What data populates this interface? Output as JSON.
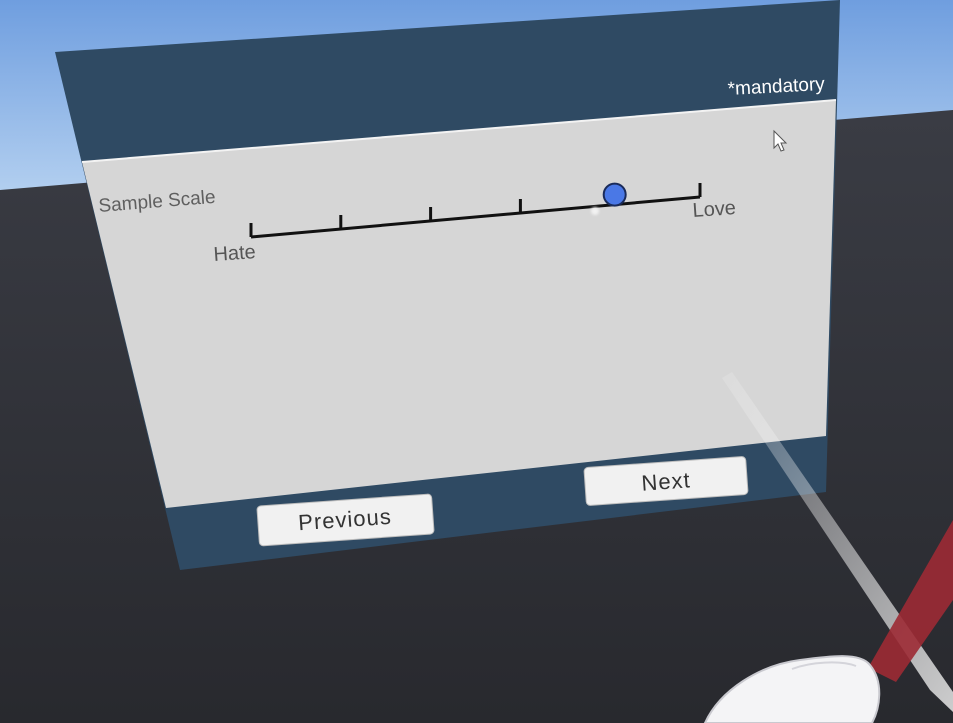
{
  "header": {
    "mandatory_note": "*mandatory"
  },
  "question": {
    "label": "Sample Scale",
    "scale": {
      "min_label": "Hate",
      "max_label": "Love",
      "tick_count": 6,
      "selected_fraction": 0.81
    }
  },
  "footer": {
    "previous_label": "Previous",
    "next_label": "Next"
  },
  "colors": {
    "panel_header": "#2f4a63",
    "panel_body": "#d6d6d6",
    "accent_handle": "#4a78e6",
    "ground": "#2b2c31",
    "sky": "#8db6e8",
    "laser_white": "#e6e6e6",
    "laser_red": "#9c2a34"
  },
  "icons": [
    "cursor-icon",
    "vr-hand-icon"
  ]
}
